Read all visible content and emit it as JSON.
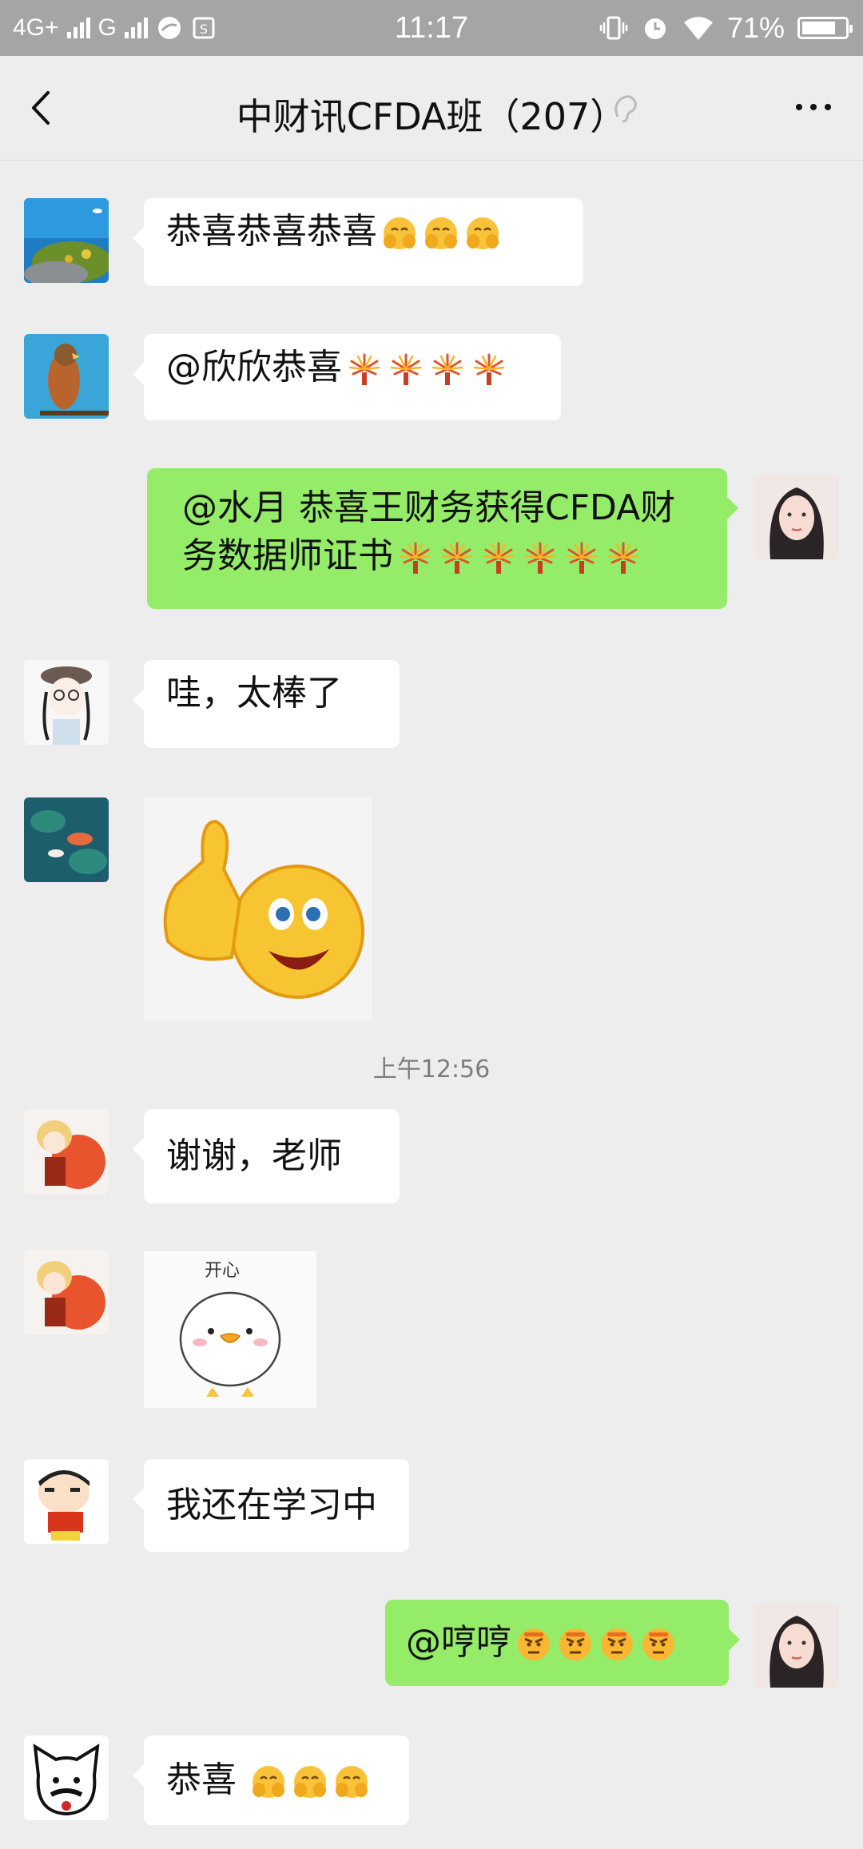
{
  "status_bar": {
    "network1": "4G+",
    "network2": "G",
    "time": "11:17",
    "battery": "71%"
  },
  "header": {
    "title": "中财讯CFDA班（207）"
  },
  "messages": [
    {
      "text": "恭喜恭喜恭喜"
    },
    {
      "text": "@欣欣恭喜"
    },
    {
      "line1": "@水月 恭喜王财务获得CFDA财",
      "line2": "务数据师证书"
    },
    {
      "text": "哇，太棒了"
    },
    {
      "sticker": "thumbs-up-smiley"
    },
    {
      "text": "谢谢，老师"
    },
    {
      "sticker_text": "开心"
    },
    {
      "text": "我还在学习中"
    },
    {
      "text": "@哼哼"
    },
    {
      "text": "恭喜"
    }
  ],
  "timestamp": "上午12:56"
}
